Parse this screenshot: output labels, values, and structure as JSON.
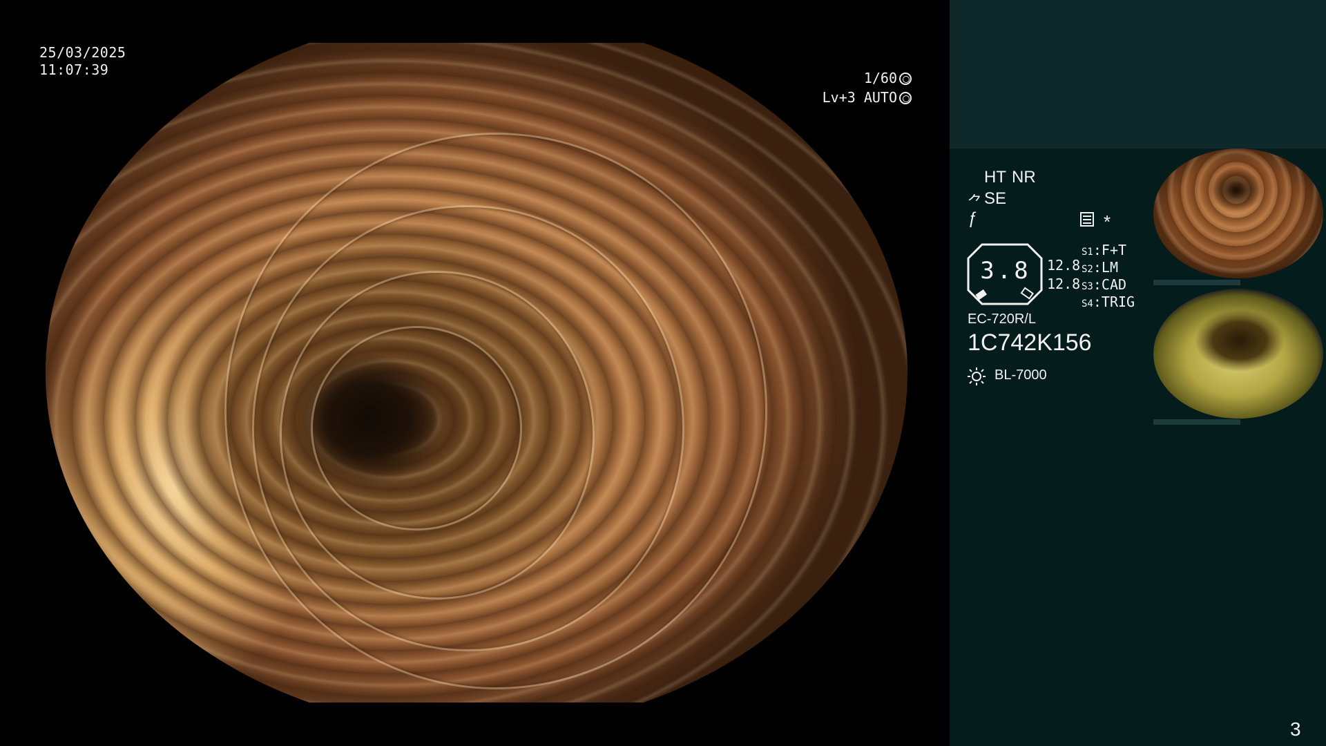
{
  "overlay": {
    "date": "25/03/2025",
    "time": "11:07:39",
    "shutter": "1/60",
    "level": "Lv+3 AUTO"
  },
  "panel": {
    "ht": "HT",
    "nr": "NR",
    "se": "SE",
    "star": "*",
    "zoom_value": "3.8",
    "value_a": "12.8",
    "value_b": "12.8",
    "slots": [
      {
        "key": "S1",
        "value": "F+T"
      },
      {
        "key": "S2",
        "value": "LM"
      },
      {
        "key": "S3",
        "value": "CAD"
      },
      {
        "key": "S4",
        "value": "TRIG"
      }
    ],
    "model": "EC-720R/L",
    "serial": "1C742K156",
    "light_source": "BL-7000",
    "page_number": "3"
  },
  "colors": {
    "accent_orange": "#f5a623",
    "panel_top": "#0f2829",
    "panel_main": "#051c1c"
  },
  "icons": {
    "shutter": "aperture-icon",
    "level": "auto-iris-icon",
    "se": "structure-enhance-icon",
    "f": "freeze-icon",
    "menu": "menu-list-icon",
    "light": "light-source-icon"
  }
}
